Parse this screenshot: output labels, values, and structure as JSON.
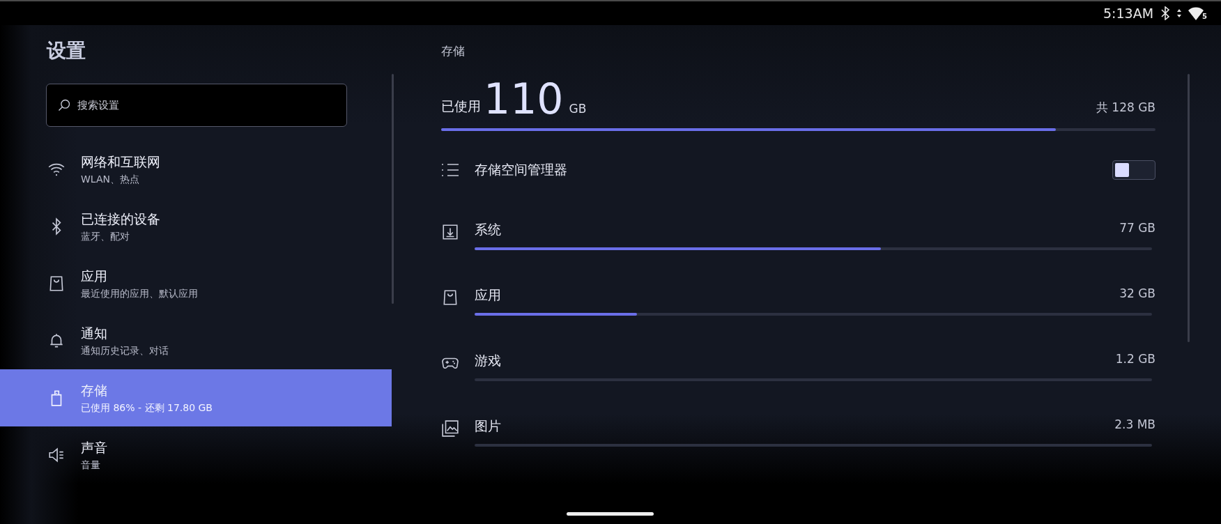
{
  "status_bar": {
    "time": "5:13AM",
    "signal_badge": "5"
  },
  "sidebar": {
    "title": "设置",
    "search": {
      "placeholder": "搜索设置"
    },
    "items": [
      {
        "kind": "wifi",
        "title": "网络和互联网",
        "subtitle": "WLAN、热点",
        "selected": false
      },
      {
        "kind": "bluetooth",
        "title": "已连接的设备",
        "subtitle": "蓝牙、配对",
        "selected": false
      },
      {
        "kind": "apps",
        "title": "应用",
        "subtitle": "最近使用的应用、默认应用",
        "selected": false
      },
      {
        "kind": "bell",
        "title": "通知",
        "subtitle": "通知历史记录、对话",
        "selected": false
      },
      {
        "kind": "storage",
        "title": "存储",
        "subtitle": "已使用 86% - 还剩 17.80 GB",
        "selected": true
      },
      {
        "kind": "sound",
        "title": "声音",
        "subtitle": "音量",
        "selected": false
      }
    ]
  },
  "storage": {
    "heading": "存储",
    "used_label": "已使用",
    "used_value": "110",
    "used_unit": "GB",
    "total": "共 128 GB",
    "level": 0.86,
    "manager": {
      "label": "存储空间管理器",
      "on": false
    },
    "categories": [
      {
        "kind": "system",
        "label": "系统",
        "size": "77 GB",
        "level": 0.6
      },
      {
        "kind": "apps",
        "label": "应用",
        "size": "32 GB",
        "level": 0.24
      },
      {
        "kind": "games",
        "label": "游戏",
        "size": "1.2 GB",
        "level": 0
      },
      {
        "kind": "images",
        "label": "图片",
        "size": "2.3 MB",
        "level": 0
      }
    ]
  }
}
